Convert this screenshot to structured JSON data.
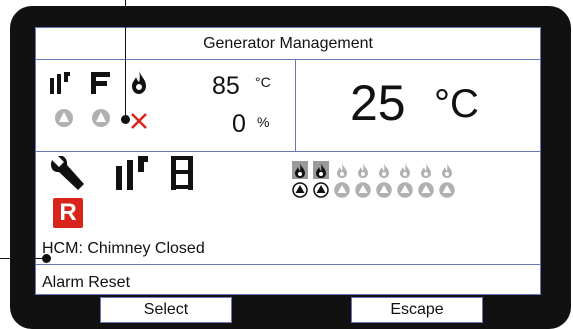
{
  "header": {
    "title": "Generator Management"
  },
  "status": {
    "supply_temp_value": "85",
    "supply_temp_unit": "°C",
    "percent_value": "0",
    "percent_unit": "%",
    "current_temp_value": "25",
    "current_temp_unit": "°C"
  },
  "alarm": {
    "message": "HCM: Chimney Closed",
    "reset_label": "Alarm Reset",
    "badge": "R"
  },
  "softkeys": {
    "select": "Select",
    "escape": "Escape"
  },
  "burners": {
    "count": 8,
    "active": [
      true,
      true,
      false,
      false,
      false,
      false,
      false,
      false
    ]
  },
  "colors": {
    "accent": "#6b76b8",
    "alarm": "#d9241b",
    "inactive": "#b0b0b0"
  }
}
